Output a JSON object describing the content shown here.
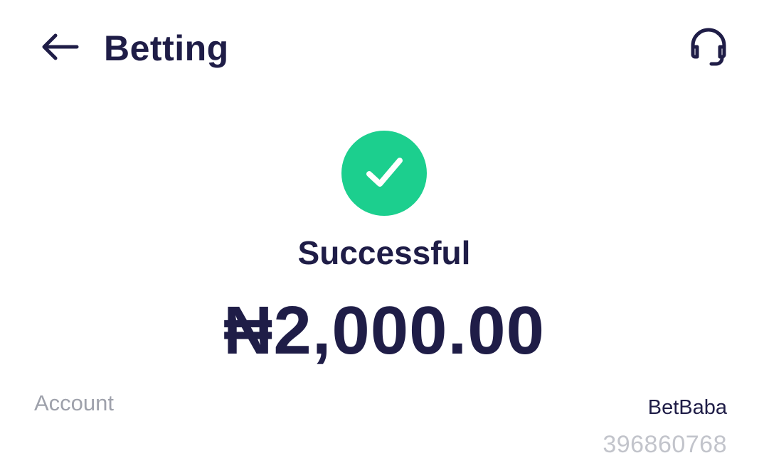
{
  "header": {
    "title": "Betting",
    "back_icon": "arrow-left-icon",
    "support_icon": "headset-icon"
  },
  "status": {
    "icon": "checkmark-icon",
    "label": "Successful",
    "color": "#1ccf8e"
  },
  "amount": {
    "display": "₦2,000.00"
  },
  "details": {
    "account_label": "Account",
    "account_name": "BetBaba",
    "account_number": "396860768"
  },
  "colors": {
    "text_primary": "#1f1d47",
    "text_secondary": "#9ea1ab",
    "success": "#1ccf8e"
  }
}
